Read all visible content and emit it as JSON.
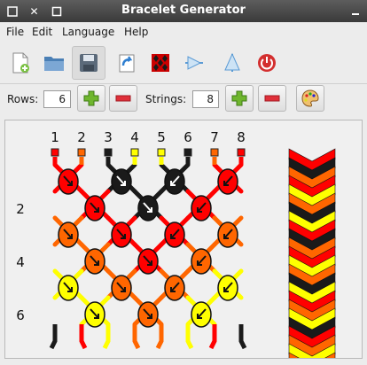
{
  "window": {
    "title": "Bracelet Generator"
  },
  "menu": [
    "File",
    "Edit",
    "Language",
    "Help"
  ],
  "toolbar": {
    "icons": [
      "new-file-icon",
      "open-folder-icon",
      "save-icon",
      "export-icon",
      "random-pattern-icon",
      "flip-icon",
      "mirror-icon",
      "quit-icon"
    ]
  },
  "rows": {
    "label": "Rows:",
    "value": "6"
  },
  "strings": {
    "label": "Strings:",
    "value": "8"
  },
  "string_numbers": [
    "1",
    "2",
    "3",
    "4",
    "5",
    "6",
    "7",
    "8"
  ],
  "row_labels": [
    "2",
    "4",
    "6"
  ],
  "colors": {
    "red": "#ff0000",
    "orange": "#ff6600",
    "black": "#1a1a1a",
    "yellow": "#ffff00"
  },
  "string_colors": [
    "red",
    "orange",
    "black",
    "yellow",
    "yellow",
    "black",
    "orange",
    "red"
  ],
  "knots": [
    [
      {
        "color": "red",
        "dir": "dr"
      },
      {
        "color": "black",
        "dir": "dr"
      },
      {
        "color": "black",
        "dir": "dl"
      },
      {
        "color": "red",
        "dir": "dl"
      }
    ],
    [
      {
        "color": "red",
        "dir": "dr"
      },
      {
        "color": "black",
        "dir": "dr"
      },
      {
        "color": "red",
        "dir": "dl"
      }
    ],
    [
      {
        "color": "orange",
        "dir": "dr"
      },
      {
        "color": "red",
        "dir": "dr"
      },
      {
        "color": "red",
        "dir": "dl"
      },
      {
        "color": "orange",
        "dir": "dl"
      }
    ],
    [
      {
        "color": "orange",
        "dir": "dr"
      },
      {
        "color": "red",
        "dir": "dr"
      },
      {
        "color": "orange",
        "dir": "dl"
      }
    ],
    [
      {
        "color": "yellow",
        "dir": "dr"
      },
      {
        "color": "orange",
        "dir": "dr"
      },
      {
        "color": "orange",
        "dir": "dl"
      },
      {
        "color": "yellow",
        "dir": "dl"
      }
    ],
    [
      {
        "color": "yellow",
        "dir": "dr"
      },
      {
        "color": "orange",
        "dir": "dr"
      },
      {
        "color": "yellow",
        "dir": "dl"
      }
    ]
  ],
  "bottom_strings": [
    "black",
    "red",
    "yellow",
    "orange",
    "orange",
    "yellow",
    "red",
    "black"
  ],
  "preview_rows": [
    "red",
    "black",
    "orange",
    "red",
    "yellow",
    "orange",
    "black",
    "yellow",
    "red",
    "black",
    "orange",
    "red",
    "yellow",
    "orange",
    "black",
    "yellow",
    "red",
    "orange",
    "yellow",
    "black",
    "red",
    "orange",
    "yellow",
    "orange"
  ]
}
